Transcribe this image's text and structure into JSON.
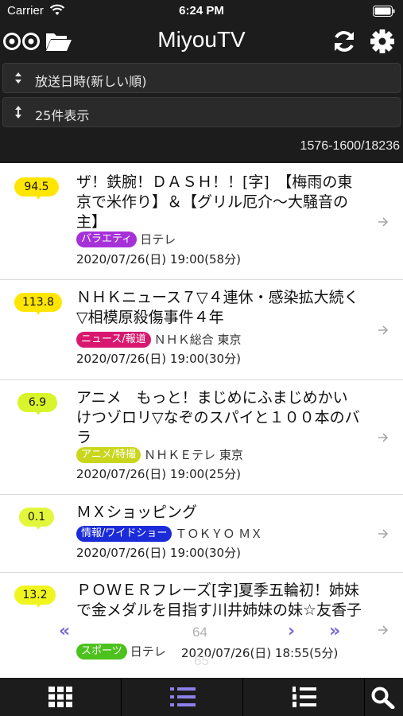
{
  "status_bar": {
    "carrier": "Carrier",
    "time": "6:24 PM"
  },
  "nav": {
    "title": "MiyouTV"
  },
  "controls": {
    "sort_label": "放送日時(新しい順)",
    "count_label": "25件表示",
    "range": "1576-1600/18236"
  },
  "programs": [
    {
      "score": "94.5",
      "score_color": "#ffe600",
      "title": "ザ！鉄腕！ＤＡＳＨ！！[字]　【梅雨の東京で米作り】＆【グリル厄介～大騒音の主】",
      "genre": "バラエティ",
      "genre_color": "#a531d8",
      "channel": "日テレ",
      "datetime": "2020/07/26(日)  19:00(58分)"
    },
    {
      "score": "113.8",
      "score_color": "#ffe600",
      "title": "ＮＨＫニュース７▽４連休・感染拡大続く▽相模原殺傷事件４年",
      "genre": "ニュース/報道",
      "genre_color": "#d8186f",
      "channel": "ＮＨＫ総合 東京",
      "datetime": "2020/07/26(日)  19:00(30分)"
    },
    {
      "score": "6.9",
      "score_color": "#d7f52a",
      "title": "アニメ　もっと！まじめにふまじめかいけつゾロリ▽なぞのスパイと１００本のバラ",
      "genre": "アニメ/特撮",
      "genre_color": "#c9d61c",
      "channel": "ＮＨＫＥテレ 東京",
      "datetime": "2020/07/26(日)  19:00(25分)"
    },
    {
      "score": "0.1",
      "score_color": "#e2f73c",
      "title": "ＭＸショッピング",
      "genre": "情報/ワイドショー",
      "genre_color": "#1b2bd8",
      "channel": "ＴＯＫＹＯ ＭＸ",
      "datetime": "2020/07/26(日)  19:00(30分)"
    },
    {
      "score": "13.2",
      "score_color": "#f0f520",
      "title": "ＰＯＷＥＲフレーズ[字]夏季五輪初！姉妹で金メダルを目指す川井姉妹の妹☆友香子",
      "genre": "スポーツ",
      "genre_color": "#4cc21d",
      "channel": "日テレ",
      "datetime": "2020/07/26(日)  18:55(5分)"
    }
  ],
  "overlay": {
    "page_current": "64",
    "page_next": "65"
  },
  "tabs": [
    {
      "name": "grid-tab",
      "icon": "grid-icon"
    },
    {
      "name": "list-tab",
      "icon": "list-icon"
    },
    {
      "name": "ranking-tab",
      "icon": "numbered-list-icon"
    },
    {
      "name": "search-tab",
      "icon": "search-icon"
    }
  ],
  "colors": {
    "bar_background": "#1c1c1c",
    "accent": "#7a6ad8"
  }
}
